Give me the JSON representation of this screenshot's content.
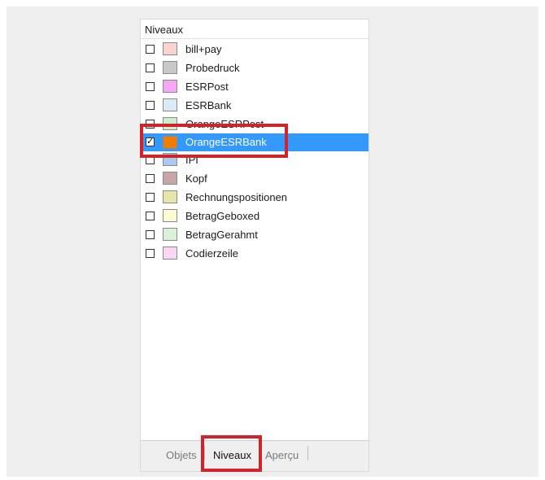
{
  "panel": {
    "header": "Niveaux"
  },
  "layers": [
    {
      "label": "bill+pay",
      "checked": false,
      "color": "#f8d3cf"
    },
    {
      "label": "Probedruck",
      "checked": false,
      "color": "#c8c8c8"
    },
    {
      "label": "ESRPost",
      "checked": false,
      "color": "#f5a6f5"
    },
    {
      "label": "ESRBank",
      "checked": false,
      "color": "#dce9f7"
    },
    {
      "label": "OrangeESRPost",
      "checked": false,
      "color": "#c9efcd"
    },
    {
      "label": "OrangeESRBank",
      "checked": true,
      "check_mark": "✓",
      "color": "#f07d00"
    },
    {
      "label": "IPI",
      "checked": false,
      "color": "#a9cbef"
    },
    {
      "label": "Kopf",
      "checked": false,
      "color": "#c9a5a5"
    },
    {
      "label": "Rechnungspositionen",
      "checked": false,
      "color": "#e6e6a8"
    },
    {
      "label": "BetragGeboxed",
      "checked": false,
      "color": "#fdfad6"
    },
    {
      "label": "BetragGerahmt",
      "checked": false,
      "color": "#d9f3d9"
    },
    {
      "label": "Codierzeile",
      "checked": false,
      "color": "#f9d8f6"
    }
  ],
  "selected_layer": "OrangeESRBank",
  "tabs": [
    {
      "label": "Objets",
      "active": false
    },
    {
      "label": "Niveaux",
      "active": true
    },
    {
      "label": "Aperçu",
      "active": false
    }
  ],
  "highlight_color": "#d2232a",
  "selection_color": "#3399ff"
}
